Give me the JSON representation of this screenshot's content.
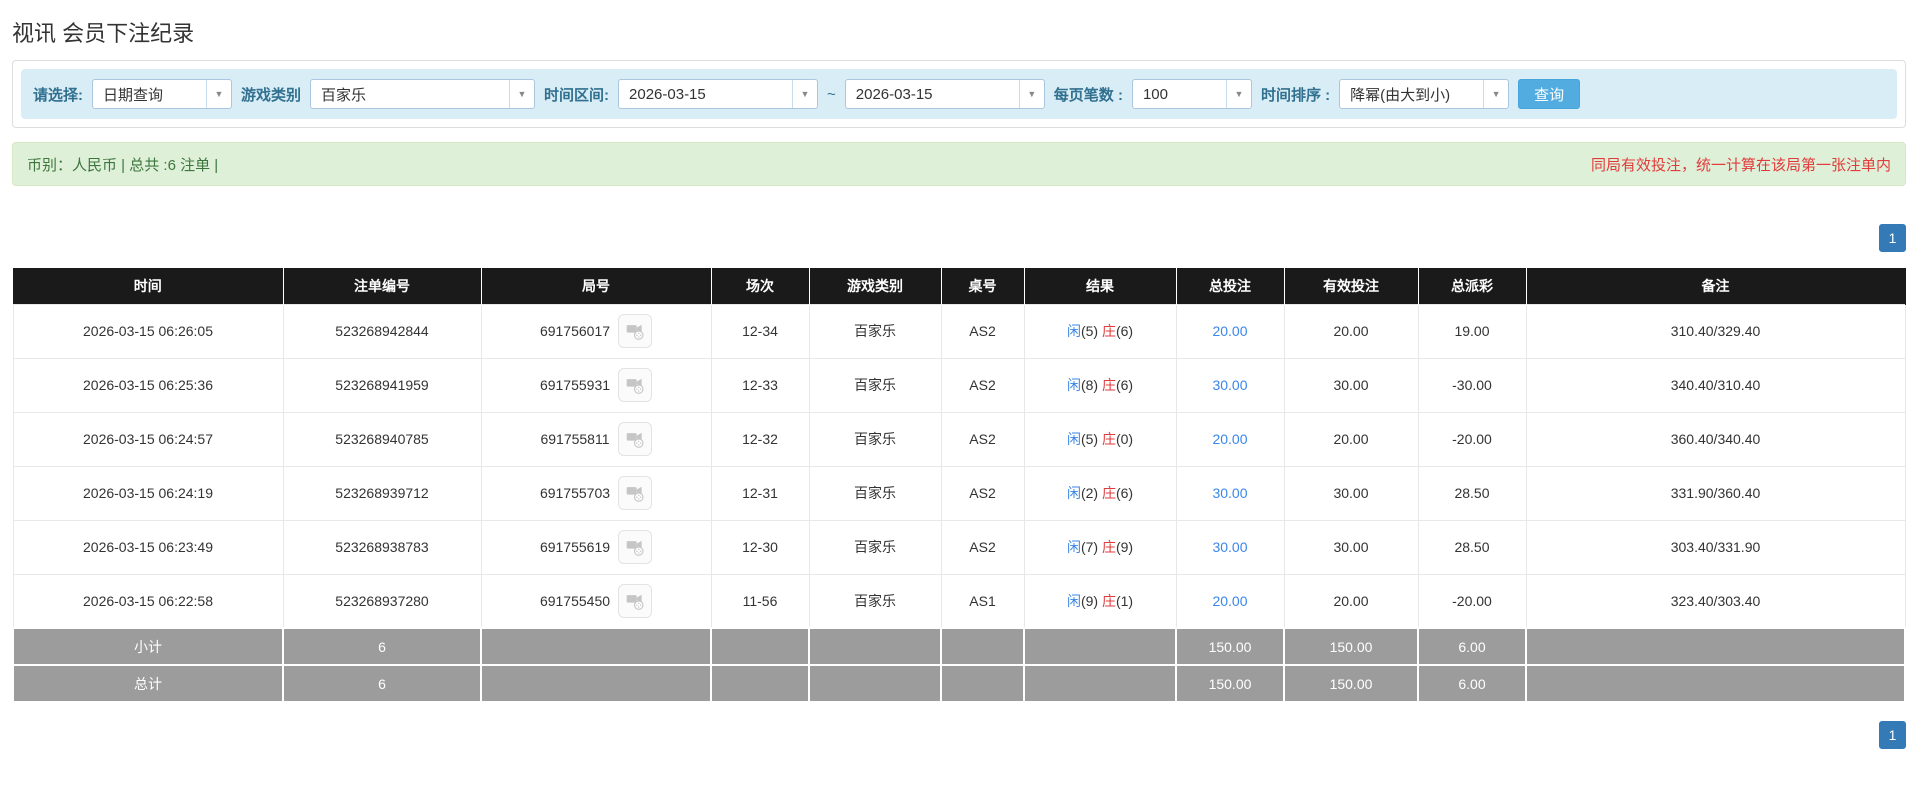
{
  "page": {
    "title": "视讯 会员下注纪录"
  },
  "colors": {
    "accent_blue": "#53acdf",
    "filter_bg": "#d9edf7",
    "filter_label": "#31708f",
    "success_bg": "#dff0d8",
    "success_text": "#3c763d",
    "alert_red": "#e23b3b",
    "link_blue": "#3a87e8",
    "header_bg": "#1a1a1a",
    "summary_row_bg": "#9c9c9c",
    "pager_active": "#337ab7"
  },
  "filters": {
    "select_label": "请选择:",
    "select_value": "日期查询",
    "category_label": "游戏类别",
    "category_value": "百家乐",
    "range_label": "时间区间:",
    "date_from": "2026-03-15",
    "tilde": "~",
    "date_to": "2026-03-15",
    "per_page_label": "每页笔数 :",
    "per_page_value": "100",
    "sort_label": "时间排序 :",
    "sort_value": "降幂(由大到小)",
    "search_button": "查询"
  },
  "summary_bar": {
    "left": "币别：人民币 | 总共 :6 注单 |",
    "right": "同局有效投注，统一计算在该局第一张注单内"
  },
  "pagination": {
    "page": "1"
  },
  "table": {
    "headers": [
      "时间",
      "注单编号",
      "局号",
      "场次",
      "游戏类别",
      "桌号",
      "结果",
      "总投注",
      "有效投注",
      "总派彩",
      "备注"
    ],
    "video_icon_name": "video-icon",
    "rows": [
      {
        "time": "2026-03-15 06:26:05",
        "bet_id": "523268942844",
        "round_id": "691756017",
        "session": "12-34",
        "game": "百家乐",
        "table_no": "AS2",
        "result": {
          "player_label": "闲",
          "player_score": "(5)",
          "banker_label": "庄",
          "banker_score": "(6)"
        },
        "total_bet": "20.00",
        "valid_bet": "20.00",
        "payout": "19.00",
        "note": "310.40/329.40"
      },
      {
        "time": "2026-03-15 06:25:36",
        "bet_id": "523268941959",
        "round_id": "691755931",
        "session": "12-33",
        "game": "百家乐",
        "table_no": "AS2",
        "result": {
          "player_label": "闲",
          "player_score": "(8)",
          "banker_label": "庄",
          "banker_score": "(6)"
        },
        "total_bet": "30.00",
        "valid_bet": "30.00",
        "payout": "-30.00",
        "note": "340.40/310.40"
      },
      {
        "time": "2026-03-15 06:24:57",
        "bet_id": "523268940785",
        "round_id": "691755811",
        "session": "12-32",
        "game": "百家乐",
        "table_no": "AS2",
        "result": {
          "player_label": "闲",
          "player_score": "(5)",
          "banker_label": "庄",
          "banker_score": "(0)"
        },
        "total_bet": "20.00",
        "valid_bet": "20.00",
        "payout": "-20.00",
        "note": "360.40/340.40"
      },
      {
        "time": "2026-03-15 06:24:19",
        "bet_id": "523268939712",
        "round_id": "691755703",
        "session": "12-31",
        "game": "百家乐",
        "table_no": "AS2",
        "result": {
          "player_label": "闲",
          "player_score": "(2)",
          "banker_label": "庄",
          "banker_score": "(6)"
        },
        "total_bet": "30.00",
        "valid_bet": "30.00",
        "payout": "28.50",
        "note": "331.90/360.40"
      },
      {
        "time": "2026-03-15 06:23:49",
        "bet_id": "523268938783",
        "round_id": "691755619",
        "session": "12-30",
        "game": "百家乐",
        "table_no": "AS2",
        "result": {
          "player_label": "闲",
          "player_score": "(7)",
          "banker_label": "庄",
          "banker_score": "(9)"
        },
        "total_bet": "30.00",
        "valid_bet": "30.00",
        "payout": "28.50",
        "note": "303.40/331.90"
      },
      {
        "time": "2026-03-15 06:22:58",
        "bet_id": "523268937280",
        "round_id": "691755450",
        "session": "11-56",
        "game": "百家乐",
        "table_no": "AS1",
        "result": {
          "player_label": "闲",
          "player_score": "(9)",
          "banker_label": "庄",
          "banker_score": "(1)"
        },
        "total_bet": "20.00",
        "valid_bet": "20.00",
        "payout": "-20.00",
        "note": "323.40/303.40"
      }
    ],
    "subtotal": {
      "label": "小计",
      "count": "6",
      "total_bet": "150.00",
      "valid_bet": "150.00",
      "payout": "6.00"
    },
    "total": {
      "label": "总计",
      "count": "6",
      "total_bet": "150.00",
      "valid_bet": "150.00",
      "payout": "6.00"
    }
  }
}
